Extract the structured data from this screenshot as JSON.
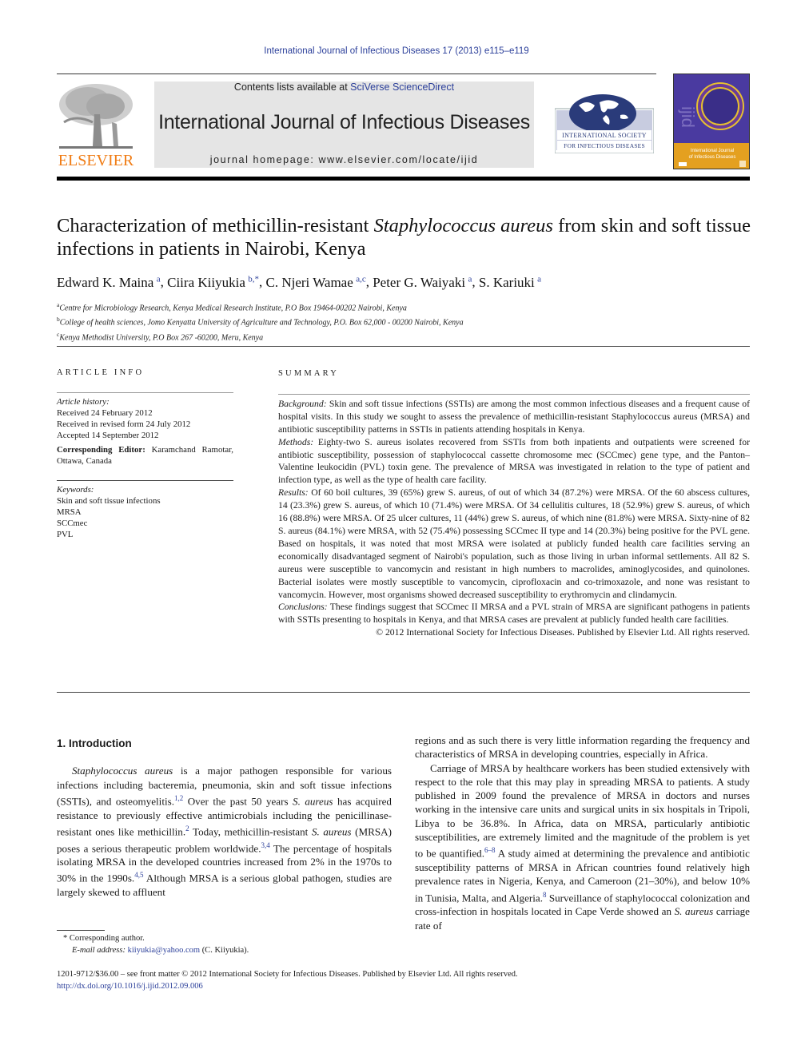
{
  "running_head": "International Journal of Infectious Diseases 17 (2013) e115–e119",
  "masthead": {
    "publisher_logo_text": "ELSEVIER",
    "contents_prefix": "Contents lists available at ",
    "contents_link": "SciVerse ScienceDirect",
    "journal_title": "International Journal of Infectious Diseases",
    "homepage": "journal homepage: www.elsevier.com/locate/ijid",
    "society_logo_lines": [
      "International Society",
      "for Infectious Diseases"
    ],
    "cover_title": "International Journal of Infectious Diseases",
    "cover_mark": "ijid",
    "colors": {
      "link": "#2b3f9a",
      "elsevier_orange": "#f07c14",
      "cover_purple": "#4a3aa0",
      "cover_orange": "#e4a020",
      "masthead_gray": "#e5e5e5"
    }
  },
  "article": {
    "title_part1": "Characterization of methicillin-resistant ",
    "title_italic": "Staphylococcus aureus",
    "title_part2": " from skin and soft tissue infections in patients in Nairobi, Kenya",
    "authors": [
      {
        "name": "Edward K. Maina",
        "sup": "a",
        "sep": ", "
      },
      {
        "name": "Ciira Kiiyukia",
        "sup": "b,*",
        "sep": ", "
      },
      {
        "name": "C. Njeri Wamae",
        "sup": "a,c",
        "sep": ", "
      },
      {
        "name": "Peter G. Waiyaki",
        "sup": "a",
        "sep": ", "
      },
      {
        "name": "S. Kariuki",
        "sup": "a",
        "sep": ""
      }
    ],
    "affiliations": [
      {
        "key": "a",
        "text": "Centre for Microbiology Research, Kenya Medical Research Institute, P.O Box 19464-00202 Nairobi, Kenya"
      },
      {
        "key": "b",
        "text": "College of health sciences, Jomo Kenyatta University of Agriculture and Technology, P.O. Box 62,000 - 00200 Nairobi, Kenya"
      },
      {
        "key": "c",
        "text": "Kenya Methodist University, P.O Box 267 -60200, Meru, Kenya"
      }
    ]
  },
  "article_info": {
    "heading": "ARTICLE INFO",
    "history_label": "Article history:",
    "history": [
      "Received 24 February 2012",
      "Received in revised form 24 July 2012",
      "Accepted 14 September 2012"
    ],
    "editor_label": "Corresponding Editor:",
    "editor_value": " Karamchand Ramotar, Ottawa, Canada",
    "keywords_label": "Keywords:",
    "keywords": [
      "Skin and soft tissue infections",
      "MRSA",
      "SCCmec",
      "PVL"
    ]
  },
  "summary": {
    "heading": "SUMMARY",
    "background_label": "Background:",
    "background": " Skin and soft tissue infections (SSTIs) are among the most common infectious diseases and a frequent cause of hospital visits. In this study we sought to assess the prevalence of methicillin-resistant Staphylococcus aureus (MRSA) and antibiotic susceptibility patterns in SSTIs in patients attending hospitals in Kenya.",
    "methods_label": "Methods:",
    "methods": " Eighty-two S. aureus isolates recovered from SSTIs from both inpatients and outpatients were screened for antibiotic susceptibility, possession of staphylococcal cassette chromosome mec (SCCmec) gene type, and the Panton–Valentine leukocidin (PVL) toxin gene. The prevalence of MRSA was investigated in relation to the type of patient and infection type, as well as the type of health care facility.",
    "results_label": "Results:",
    "results": " Of 60 boil cultures, 39 (65%) grew S. aureus, of out of which 34 (87.2%) were MRSA. Of the 60 abscess cultures, 14 (23.3%) grew S. aureus, of which 10 (71.4%) were MRSA. Of 34 cellulitis cultures, 18 (52.9%) grew S. aureus, of which 16 (88.8%) were MRSA. Of 25 ulcer cultures, 11 (44%) grew S. aureus, of which nine (81.8%) were MRSA. Sixty-nine of 82 S. aureus (84.1%) were MRSA, with 52 (75.4%) possessing SCCmec II type and 14 (20.3%) being positive for the PVL gene. Based on hospitals, it was noted that most MRSA were isolated at publicly funded health care facilities serving an economically disadvantaged segment of Nairobi's population, such as those living in urban informal settlements. All 82 S. aureus were susceptible to vancomycin and resistant in high numbers to macrolides, aminoglycosides, and quinolones. Bacterial isolates were mostly susceptible to vancomycin, ciprofloxacin and co-trimoxazole, and none was resistant to vancomycin. However, most organisms showed decreased susceptibility to erythromycin and clindamycin.",
    "conclusions_label": "Conclusions:",
    "conclusions": " These findings suggest that SCCmec II MRSA and a PVL strain of MRSA are significant pathogens in patients with SSTIs presenting to hospitals in Kenya, and that MRSA cases are prevalent at publicly funded health care facilities.",
    "copyright": "© 2012 International Society for Infectious Diseases. Published by Elsevier Ltd. All rights reserved."
  },
  "introduction": {
    "heading": "1.  Introduction",
    "p1": [
      {
        "t": "Staphylococcus aureus",
        "i": true
      },
      {
        "t": " is a major pathogen responsible for various infections including bacteremia, pneumonia, skin and soft tissue infections (SSTIs), and osteomyelitis."
      },
      {
        "t": "1,2",
        "sup": true
      },
      {
        "t": " Over the past 50 years "
      },
      {
        "t": "S. aureus",
        "i": true
      },
      {
        "t": " has acquired resistance to previously effective antimicrobials including the penicillinase-resistant ones like methicillin."
      },
      {
        "t": "2",
        "sup": true
      },
      {
        "t": " Today, methicillin-resistant "
      },
      {
        "t": "S. aureus",
        "i": true
      },
      {
        "t": " (MRSA) poses a serious therapeutic problem worldwide."
      },
      {
        "t": "3,4",
        "sup": true
      },
      {
        "t": " The percentage of hospitals isolating MRSA in the developed countries increased from 2% in the 1970s to 30% in the 1990s."
      },
      {
        "t": "4,5",
        "sup": true
      },
      {
        "t": " Although MRSA is a serious global pathogen, studies are largely skewed to affluent regions and as such there is very little information regarding the frequency and characteristics of MRSA in developing countries, especially in Africa."
      }
    ],
    "p2": [
      {
        "t": "Carriage of MRSA by healthcare workers has been studied extensively with respect to the role that this may play in spreading MRSA to patients. A study published in 2009 found the prevalence of MRSA in doctors and nurses working in the intensive care units and surgical units in six hospitals in Tripoli, Libya to be 36.8%. In Africa, data on MRSA, particularly antibiotic susceptibilities, are extremely limited and the magnitude of the problem is yet to be quantified."
      },
      {
        "t": "6–8",
        "sup": true
      },
      {
        "t": " A study aimed at determining the prevalence and antibiotic susceptibility patterns of MRSA in African countries found relatively high prevalence rates in Nigeria, Kenya, and Cameroon (21–30%), and below 10% in Tunisia, Malta, and Algeria."
      },
      {
        "t": "8",
        "sup": true
      },
      {
        "t": " Surveillance of staphylococcal colonization and cross-infection in hospitals located in Cape Verde showed an "
      },
      {
        "t": "S. aureus",
        "i": true
      },
      {
        "t": " carriage rate of"
      }
    ]
  },
  "footnote": {
    "marker": "*",
    "text": " Corresponding author.",
    "email_label": "E-mail address:",
    "email": "kiiyukia@yahoo.com",
    "email_suffix": " (C. Kiiyukia)."
  },
  "bottom": {
    "issn_line": "1201-9712/$36.00 – see front matter © 2012 International Society for Infectious Diseases. Published by Elsevier Ltd. All rights reserved.",
    "doi": "http://dx.doi.org/10.1016/j.ijid.2012.09.006"
  }
}
